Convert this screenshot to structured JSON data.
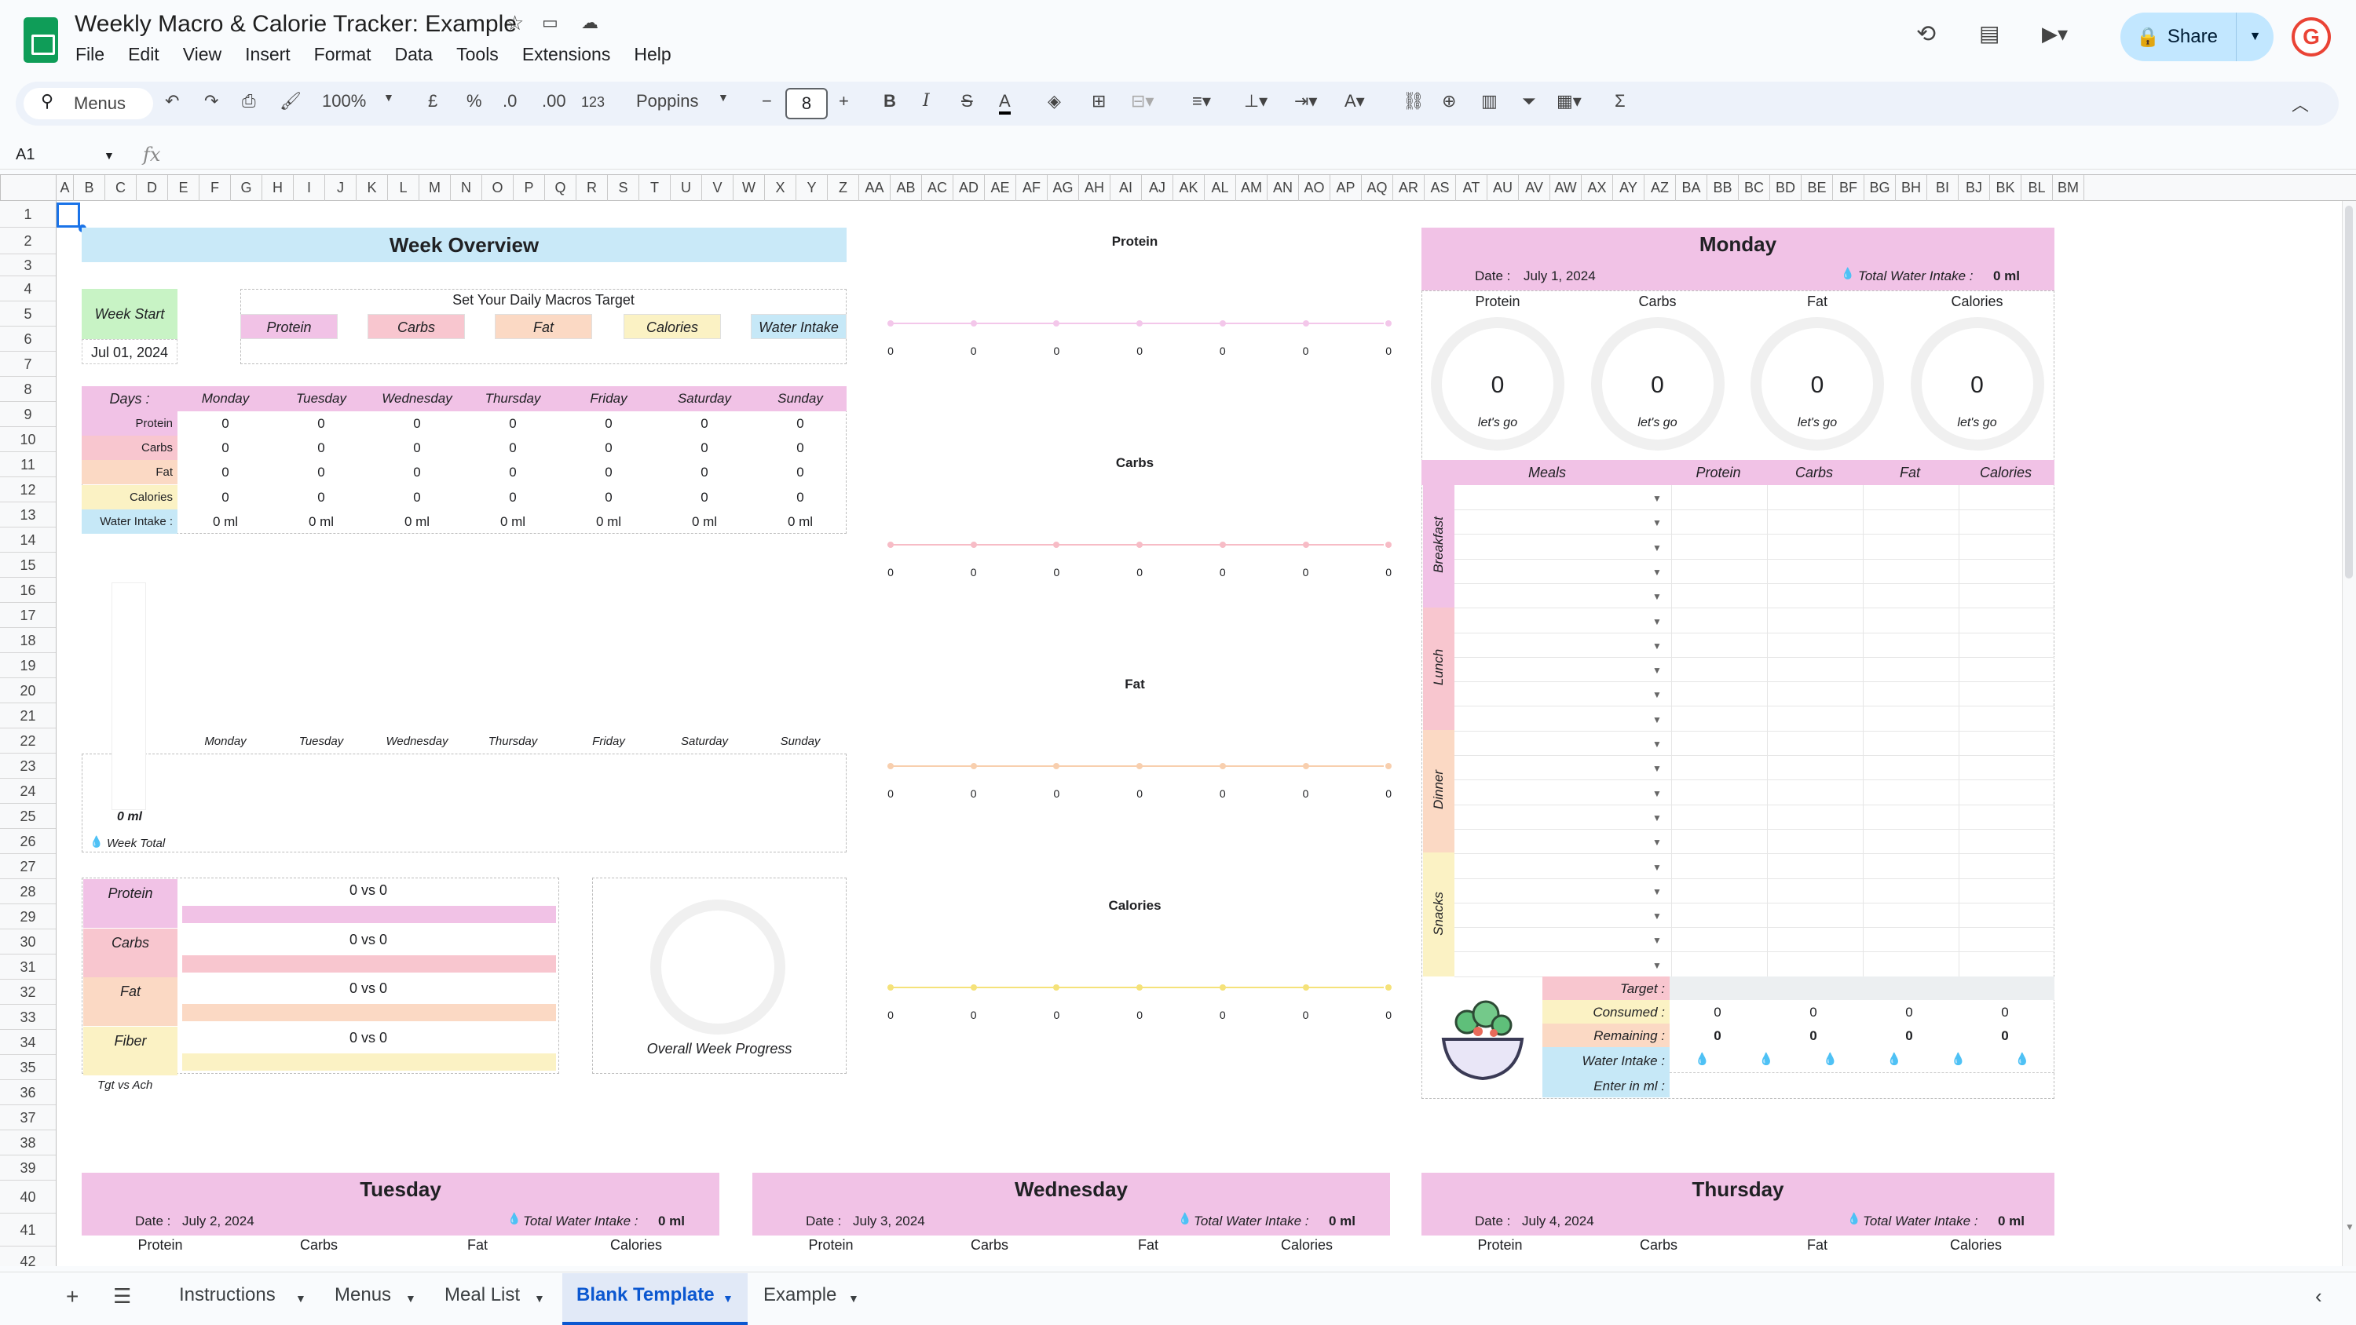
{
  "app": {
    "title": "Weekly Macro & Calorie Tracker: Example",
    "share_label": "Share",
    "avatar_letter": "G"
  },
  "menu": [
    "File",
    "Edit",
    "View",
    "Insert",
    "Format",
    "Data",
    "Tools",
    "Extensions",
    "Help"
  ],
  "toolbar": {
    "search_label": "Menus",
    "zoom": "100%",
    "currency": "£",
    "percent": "%",
    "dec_less": ".0",
    "dec_more": ".00",
    "num_format": "123",
    "font": "Poppins",
    "font_size": "8"
  },
  "formula": {
    "cell": "A1",
    "fx": "fx"
  },
  "columns": [
    "A",
    "B",
    "C",
    "D",
    "E",
    "F",
    "G",
    "H",
    "I",
    "J",
    "K",
    "L",
    "M",
    "N",
    "O",
    "P",
    "Q",
    "R",
    "S",
    "T",
    "U",
    "V",
    "W",
    "X",
    "Y",
    "Z",
    "AA",
    "AB",
    "AC",
    "AD",
    "AE",
    "AF",
    "AG",
    "AH",
    "AI",
    "AJ",
    "AK",
    "AL",
    "AM",
    "AN",
    "AO",
    "AP",
    "AQ",
    "AR",
    "AS",
    "AT",
    "AU",
    "AV",
    "AW",
    "AX",
    "AY",
    "AZ",
    "BA",
    "BB",
    "BC",
    "BD",
    "BE",
    "BF",
    "BG",
    "BH",
    "BI",
    "BJ",
    "BK",
    "BL",
    "BM"
  ],
  "week": {
    "title": "Week Overview",
    "week_start_label": "Week Start",
    "week_start": "Jul 01, 2024",
    "targets_label": "Set Your Daily Macros Target",
    "targets": [
      "Protein",
      "Carbs",
      "Fat",
      "Calories",
      "Water Intake"
    ],
    "days_label": "Days :",
    "days": [
      "Monday",
      "Tuesday",
      "Wednesday",
      "Thursday",
      "Friday",
      "Saturday",
      "Sunday"
    ],
    "rows": [
      {
        "label": "Protein",
        "values": [
          "0",
          "0",
          "0",
          "0",
          "0",
          "0",
          "0"
        ]
      },
      {
        "label": "Carbs",
        "values": [
          "0",
          "0",
          "0",
          "0",
          "0",
          "0",
          "0"
        ]
      },
      {
        "label": "Fat",
        "values": [
          "0",
          "0",
          "0",
          "0",
          "0",
          "0",
          "0"
        ]
      },
      {
        "label": "Calories",
        "values": [
          "0",
          "0",
          "0",
          "0",
          "0",
          "0",
          "0"
        ]
      },
      {
        "label": "Water Intake :",
        "values": [
          "0 ml",
          "0 ml",
          "0 ml",
          "0 ml",
          "0 ml",
          "0 ml",
          "0 ml"
        ]
      }
    ],
    "water_total": "0 ml",
    "week_total_label": "Week Total",
    "progress": [
      {
        "label": "Protein",
        "text": "0 vs 0"
      },
      {
        "label": "Carbs",
        "text": "0 vs 0"
      },
      {
        "label": "Fat",
        "text": "0 vs 0"
      },
      {
        "label": "Fiber",
        "text": "0 vs 0"
      }
    ],
    "tgt_vs_ach": "Tgt vs Ach",
    "overall_label": "Overall Week Progress"
  },
  "charts": [
    {
      "title": "Protein",
      "values": [
        "0",
        "0",
        "0",
        "0",
        "0",
        "0",
        "0"
      ]
    },
    {
      "title": "Carbs",
      "values": [
        "0",
        "0",
        "0",
        "0",
        "0",
        "0",
        "0"
      ]
    },
    {
      "title": "Fat",
      "values": [
        "0",
        "0",
        "0",
        "0",
        "0",
        "0",
        "0"
      ]
    },
    {
      "title": "Calories",
      "values": [
        "0",
        "0",
        "0",
        "0",
        "0",
        "0",
        "0"
      ]
    }
  ],
  "monday": {
    "title": "Monday",
    "date_label": "Date :",
    "date": "July 1, 2024",
    "water_label": "Total Water Intake :",
    "water": "0 ml",
    "macros": [
      "Protein",
      "Carbs",
      "Fat",
      "Calories"
    ],
    "ring_value": "0",
    "ring_text": "let's go",
    "table_headers": [
      "Meals",
      "Protein",
      "Carbs",
      "Fat",
      "Calories"
    ],
    "meals": [
      "Breakfast",
      "Lunch",
      "Dinner",
      "Snacks"
    ],
    "summary": {
      "target": "Target :",
      "consumed": "Consumed :",
      "remaining": "Remaining :",
      "water": "Water Intake :",
      "enter": "Enter in ml :",
      "consumed_values": [
        "0",
        "0",
        "0",
        "0"
      ],
      "remaining_values": [
        "0",
        "0",
        "0",
        "0"
      ]
    }
  },
  "days_below": [
    {
      "title": "Tuesday",
      "date": "July 2, 2024"
    },
    {
      "title": "Wednesday",
      "date": "July 3, 2024"
    },
    {
      "title": "Thursday",
      "date": "July 4, 2024"
    }
  ],
  "tabs": [
    "Instructions",
    "Menus",
    "Meal List",
    "Blank Template",
    "Example"
  ],
  "colors": {
    "protein": "#f1c2e6",
    "carbs": "#f8c6cf",
    "fat": "#fbd9c4",
    "calories": "#fbf2c4",
    "water": "#c6e8f7",
    "header_blue": "#c9e9f8",
    "week_green": "#c8f3c5"
  }
}
